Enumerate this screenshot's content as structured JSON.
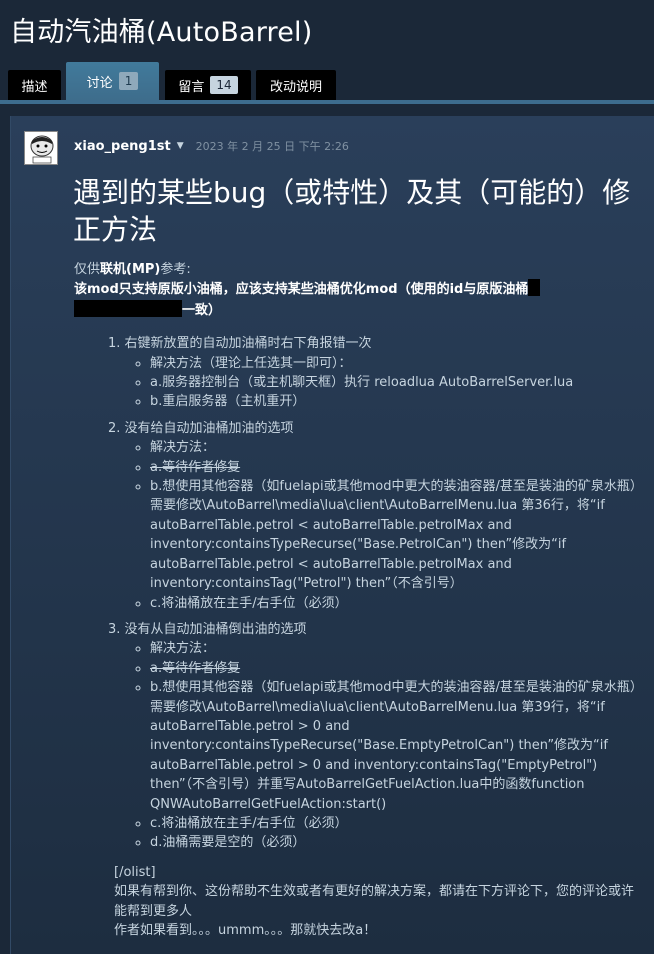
{
  "page": {
    "title": "自动汽油桶(AutoBarrel)"
  },
  "tabs": [
    {
      "label": "描述",
      "badge": null
    },
    {
      "label": "讨论",
      "badge": "1"
    },
    {
      "label": "留言",
      "badge": "14"
    },
    {
      "label": "改动说明",
      "badge": null
    }
  ],
  "post": {
    "author": "xiao_peng1st",
    "date": "2023 年 2 月 25 日 下午 2:26",
    "heading": "遇到的某些bug（或特性）及其（可能的）修正方法",
    "intro_prefix": "仅供",
    "intro_bold": "联机(MP)",
    "intro_suffix": "参考:",
    "note_a": "该mod只支持原版小油桶，应该支持某些油桶优化mod（使用的id与原版油桶",
    "note_b": "一致）",
    "items": [
      {
        "title": "1. 右键新放置的自动加油桶时右下角报错一次",
        "subs": [
          "解决方法（理论上任选其一即可）：",
          "a.服务器控制台（或主机聊天框）执行 reloadlua AutoBarrelServer.lua",
          "b.重启服务器（主机重开）"
        ]
      },
      {
        "title": "2. 没有给自动加油桶加油的选项",
        "subs": [
          "解决方法：",
          "a.等待作者修复",
          "b.想使用其他容器（如fuelapi或其他mod中更大的装油容器/甚至是装油的矿泉水瓶）需要修改\\AutoBarrel\\media\\lua\\client\\AutoBarrelMenu.lua 第36行，将“if autoBarrelTable.petrol < autoBarrelTable.petrolMax and inventory:containsTypeRecurse(\"Base.PetrolCan\") then”修改为“if autoBarrelTable.petrol < autoBarrelTable.petrolMax and inventory:containsTag(\"Petrol\") then”（不含引号）",
          "c.将油桶放在主手/右手位（必须）"
        ]
      },
      {
        "title": "3. 没有从自动加油桶倒出油的选项",
        "subs": [
          "解决方法：",
          "a.等待作者修复",
          "b.想使用其他容器（如fuelapi或其他mod中更大的装油容器/甚至是装油的矿泉水瓶）需要修改\\AutoBarrel\\media\\lua\\client\\AutoBarrelMenu.lua 第39行，将“if autoBarrelTable.petrol > 0 and inventory:containsTypeRecurse(\"Base.EmptyPetrolCan\") then”修改为“if autoBarrelTable.petrol > 0 and inventory:containsTag(\"EmptyPetrol\") then”（不含引号）并重写AutoBarrelGetFuelAction.lua中的函数function QNWAutoBarrelGetFuelAction:start()",
          "c.将油桶放在主手/右手位（必须）",
          "d.油桶需要是空的（必须）"
        ]
      }
    ],
    "closing_tag": "[/olist]",
    "closing_1": "如果有帮到你、这份帮助不生效或者有更好的解决方案，都请在下方评论下，您的评论或许能帮到更多人",
    "closing_2": "作者如果看到。。。ummm。。。那就快去改a！"
  },
  "colors": {
    "background": "#1b2838",
    "active_tab": "#417a9b",
    "text": "#c6d4df"
  }
}
